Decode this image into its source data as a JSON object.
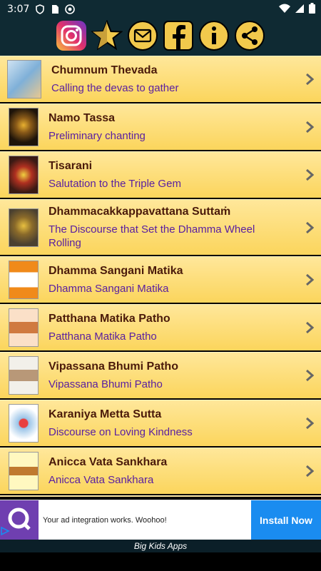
{
  "status_bar": {
    "time": "3:07"
  },
  "toolbar": {
    "buttons": [
      {
        "icon": "instagram-icon"
      },
      {
        "icon": "star-rate-icon"
      },
      {
        "icon": "mail-icon"
      },
      {
        "icon": "facebook-icon"
      },
      {
        "icon": "info-icon"
      },
      {
        "icon": "share-icon"
      }
    ]
  },
  "list": {
    "items": [
      {
        "title": "Chumnum Thevada",
        "subtitle": "Calling the devas to gather",
        "thumb_color": "#7fb0d8"
      },
      {
        "title": "Namo Tassa",
        "subtitle": "Preliminary chanting",
        "thumb_color": "#3a2a18"
      },
      {
        "title": "Tisarani",
        "subtitle": "Salutation to the Triple Gem",
        "thumb_color": "#5a2a20"
      },
      {
        "title": "Dhammacakkappavattana Suttaṁ",
        "subtitle": "The Discourse that Set the Dhamma Wheel Rolling",
        "thumb_color": "#6a5a30"
      },
      {
        "title": "Dhamma Sangani Matika",
        "subtitle": "Dhamma Sangani Matika",
        "thumb_color": "#f08a1a"
      },
      {
        "title": "Patthana Matika Patho",
        "subtitle": "Patthana Matika Patho",
        "thumb_color": "#f4c8a0"
      },
      {
        "title": "Vipassana Bhumi Patho",
        "subtitle": "Vipassana Bhumi Patho",
        "thumb_color": "#e0ddd6"
      },
      {
        "title": "Karaniya Metta Sutta",
        "subtitle": "Discourse on Loving Kindness",
        "thumb_color": "#9ac4e8"
      },
      {
        "title": "Anicca Vata Sankhara",
        "subtitle": "Anicca Vata Sankhara",
        "thumb_color": "#fff6b0"
      }
    ]
  },
  "ad": {
    "text": "Your ad integration works. Woohoo!",
    "button": "Install Now"
  },
  "footer": {
    "text": "Big Kids Apps"
  }
}
